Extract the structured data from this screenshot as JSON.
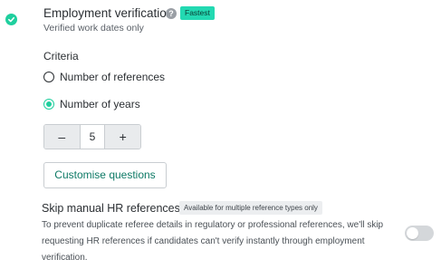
{
  "section": {
    "title": "Employment verification",
    "badge": "Fastest",
    "subtitle": "Verified work dates only",
    "help_icon": "question-mark-icon",
    "status_icon": "check-circle-icon",
    "checked": true
  },
  "criteria": {
    "label": "Criteria",
    "options": [
      {
        "label": "Number of references",
        "selected": false
      },
      {
        "label": "Number of years",
        "selected": true
      }
    ]
  },
  "stepper": {
    "decrement_label": "–",
    "value": "5",
    "increment_label": "+"
  },
  "customise": {
    "label": "Customise questions"
  },
  "skip_hr": {
    "title": "Skip manual HR references",
    "badge": "Available for multiple reference types only",
    "description": "To prevent duplicate referee details in regulatory or professional references, we'll skip requesting HR references if candidates can't verify instantly through employment verification.",
    "toggle_on": false
  },
  "colors": {
    "accent": "#1fcf9e",
    "badge_bg": "#23d9b2",
    "link_text": "#0e7a66",
    "toggle_off": "#d4d7da"
  }
}
